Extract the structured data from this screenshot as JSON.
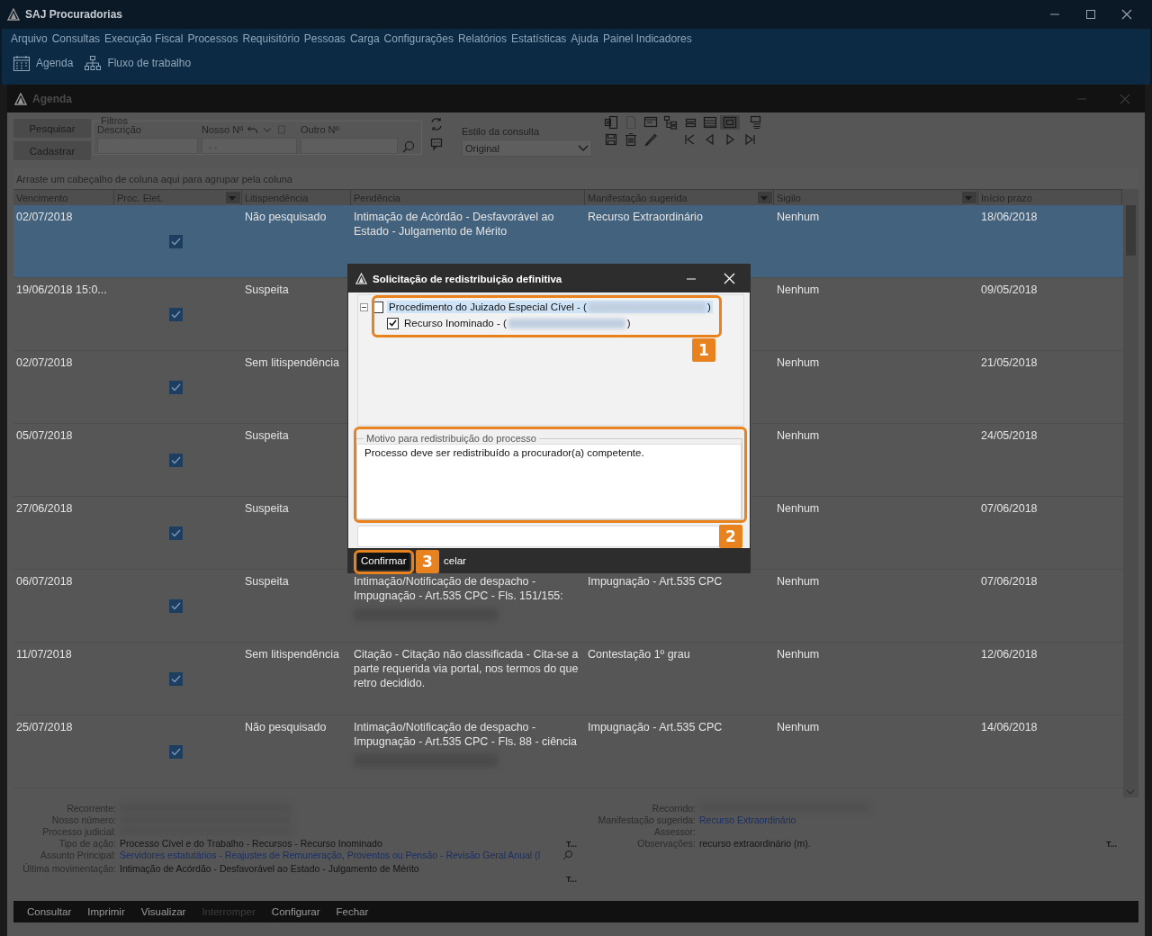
{
  "app": {
    "title": "SAJ Procuradorias"
  },
  "menu": [
    "Arquivo",
    "Consultas",
    "Execução Fiscal",
    "Processos",
    "Requisitório",
    "Pessoas",
    "Carga",
    "Configurações",
    "Relatórios",
    "Estatísticas",
    "Ajuda",
    "Painel Indicadores"
  ],
  "toolbar": [
    {
      "label": "Agenda",
      "kind": "calendar"
    },
    {
      "label": "Fluxo de trabalho",
      "kind": "flow"
    }
  ],
  "child_window": {
    "title": "Agenda"
  },
  "filters": {
    "buttons": [
      "Pesquisar",
      "Cadastrar"
    ],
    "group_title": "Filtros",
    "descricao": {
      "label": "Descrição"
    },
    "nosso_numero": {
      "label": "Nosso Nº",
      "placeholder": " . ."
    },
    "outro_numero": {
      "label": "Outro Nº"
    },
    "query_style": {
      "label": "Estilo da consulta",
      "value": "Original"
    }
  },
  "grid": {
    "group_hint": "Arraste um cabeçalho de coluna aqui para agrupar pela coluna",
    "columns": [
      {
        "label": "Vencimento"
      },
      {
        "label": "Proc. Elet.",
        "filter": true
      },
      {
        "label": "Litispendência"
      },
      {
        "label": "Pendência"
      },
      {
        "label": "Manifestação sugerida",
        "filter": true
      },
      {
        "label": "Sigilo",
        "filter": true
      },
      {
        "label": "Início prazo"
      }
    ],
    "rows": [
      {
        "vencimento": "02/07/2018",
        "proc_elet": true,
        "litispendencia": "Não pesquisado",
        "pendencia": "Intimação de Acórdão - Desfavorável ao Estado - Julgamento de Mérito",
        "manifestacao": "Recurso Extraordinário",
        "sigilo": "Nenhum",
        "inicio": "18/06/2018",
        "selected": true
      },
      {
        "vencimento": "19/06/2018 15:0...",
        "proc_elet": true,
        "litispendencia": "Suspeita",
        "sigilo": "Nenhum",
        "inicio": "09/05/2018",
        "selected": false
      },
      {
        "vencimento": "02/07/2018",
        "proc_elet": true,
        "litispendencia": "Sem litispendência",
        "sigilo": "Nenhum",
        "inicio": "21/05/2018",
        "selected": false
      },
      {
        "vencimento": "05/07/2018",
        "proc_elet": true,
        "litispendencia": "Suspeita",
        "sigilo": "Nenhum",
        "inicio": "24/05/2018",
        "selected": false
      },
      {
        "vencimento": "27/06/2018",
        "proc_elet": true,
        "litispendencia": "Suspeita",
        "sigilo": "Nenhum",
        "inicio": "07/06/2018",
        "selected": false
      },
      {
        "vencimento": "06/07/2018",
        "proc_elet": true,
        "litispendencia": "Suspeita",
        "pendencia": "Intimação/Notificação de despacho - Impugnação - Art.535 CPC - Fls. 151/155:",
        "manifestacao": "Impugnação - Art.535 CPC",
        "sigilo": "Nenhum",
        "inicio": "07/06/2018",
        "redacted": true,
        "selected": false
      },
      {
        "vencimento": "11/07/2018",
        "proc_elet": true,
        "litispendencia": "Sem litispendência",
        "pendencia": "Citação - Citação não classificada - Cita-se a parte requerida via portal, nos termos do que retro decidido.",
        "manifestacao": "Contestação 1º grau",
        "sigilo": "Nenhum",
        "inicio": "12/06/2018",
        "selected": false
      },
      {
        "vencimento": "25/07/2018",
        "proc_elet": true,
        "litispendencia": "Não pesquisado",
        "pendencia": "Intimação/Notificação de despacho - Impugnação - Art.535 CPC - Fls. 88 - ciência",
        "manifestacao": "Impugnação - Art.535 CPC",
        "sigilo": "Nenhum",
        "inicio": "14/06/2018",
        "redacted": true,
        "selected": false
      }
    ]
  },
  "details": {
    "left": [
      {
        "label": "Recorrente:",
        "redacted": true
      },
      {
        "label": "Nosso número:",
        "redacted": true
      },
      {
        "label": "Processo judicial:",
        "redacted": true
      },
      {
        "label": "Tipo de ação:",
        "value": "Processo Cível e do Trabalho - Recursos - Recurso Inominado",
        "link": false,
        "trail": "T..."
      },
      {
        "label": "Assunto Principal:",
        "value": "Servidores estatutários - Reajustes de Remuneração, Proventos ou Pensão - Revisão Geral Anual (I",
        "link": true,
        "searchable": true
      },
      {
        "label": "Última movimentação:",
        "value": "Intimação de Acórdão - Desfavorável ao Estado - Julgamento de Mérito",
        "link": false,
        "trail_below": "T..."
      }
    ],
    "right": [
      {
        "label": "Recorrido:",
        "redacted": true
      },
      {
        "label": "Manifestação sugerida:",
        "value": "Recurso Extraordinário",
        "link": true
      },
      {
        "label": "Assessor:"
      },
      {
        "label": "Observações:",
        "value": "recurso extraordinário (m).",
        "link": false,
        "trail": "T..."
      }
    ]
  },
  "footer": [
    {
      "label": "Consultar",
      "disabled": false
    },
    {
      "label": "Imprimir",
      "disabled": false
    },
    {
      "label": "Visualizar",
      "disabled": false
    },
    {
      "label": "Interromper",
      "disabled": true
    },
    {
      "label": "Configurar",
      "disabled": false
    },
    {
      "label": "Fechar",
      "disabled": false
    }
  ],
  "dialog": {
    "title": "Solicitação de redistribuição definitiva",
    "tree": [
      {
        "label": "Procedimento do Juizado Especial Cível - (",
        "suffix": ")",
        "checked": false,
        "selected": true,
        "expanded": true,
        "children": [
          {
            "label": "Recurso Inominado - (",
            "suffix": ")",
            "checked": true,
            "selected": false
          }
        ]
      }
    ],
    "reason": {
      "label": "Motivo para redistribuição do processo",
      "value": "Processo deve ser redistribuído a procurador(a) competente."
    },
    "buttons": [
      "Confirmar",
      "celar"
    ],
    "annotations": [
      "1",
      "2",
      "3"
    ]
  }
}
